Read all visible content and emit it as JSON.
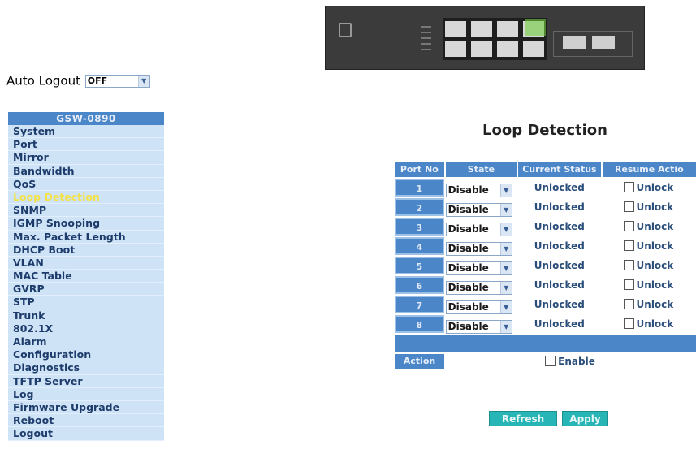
{
  "auto_logout": {
    "label": "Auto Logout",
    "value": "OFF"
  },
  "sidebar": {
    "header": "GSW-0890",
    "active": "Loop Detection",
    "items": [
      "System",
      "Port",
      "Mirror",
      "Bandwidth",
      "QoS",
      "Loop Detection",
      "SNMP",
      "IGMP Snooping",
      "Max. Packet Length",
      "DHCP Boot",
      "VLAN",
      "MAC Table",
      "GVRP",
      "STP",
      "Trunk",
      "802.1X",
      "Alarm",
      "Configuration",
      "Diagnostics",
      "TFTP Server",
      "Log",
      "Firmware Upgrade",
      "Reboot",
      "Logout"
    ]
  },
  "page": {
    "title": "Loop Detection"
  },
  "table": {
    "headers": {
      "port": "Port No",
      "state": "State",
      "status": "Current Status",
      "resume": "Resume Actio"
    },
    "rows": [
      {
        "port": "1",
        "state": "Disable",
        "status": "Unlocked",
        "resume": "Unlock"
      },
      {
        "port": "2",
        "state": "Disable",
        "status": "Unlocked",
        "resume": "Unlock"
      },
      {
        "port": "3",
        "state": "Disable",
        "status": "Unlocked",
        "resume": "Unlock"
      },
      {
        "port": "4",
        "state": "Disable",
        "status": "Unlocked",
        "resume": "Unlock"
      },
      {
        "port": "5",
        "state": "Disable",
        "status": "Unlocked",
        "resume": "Unlock"
      },
      {
        "port": "6",
        "state": "Disable",
        "status": "Unlocked",
        "resume": "Unlock"
      },
      {
        "port": "7",
        "state": "Disable",
        "status": "Unlocked",
        "resume": "Unlock"
      },
      {
        "port": "8",
        "state": "Disable",
        "status": "Unlocked",
        "resume": "Unlock"
      }
    ],
    "action_label": "Action",
    "enable_label": "Enable"
  },
  "buttons": {
    "refresh": "Refresh",
    "apply": "Apply"
  },
  "colors": {
    "header_blue": "#4a86c8",
    "sidebar_bg": "#cfe3f7",
    "active_item": "#f1e24b",
    "button_teal": "#27b5b5"
  },
  "icons": {
    "dropdown": "chevron-down-icon",
    "checkbox": "checkbox-icon"
  }
}
